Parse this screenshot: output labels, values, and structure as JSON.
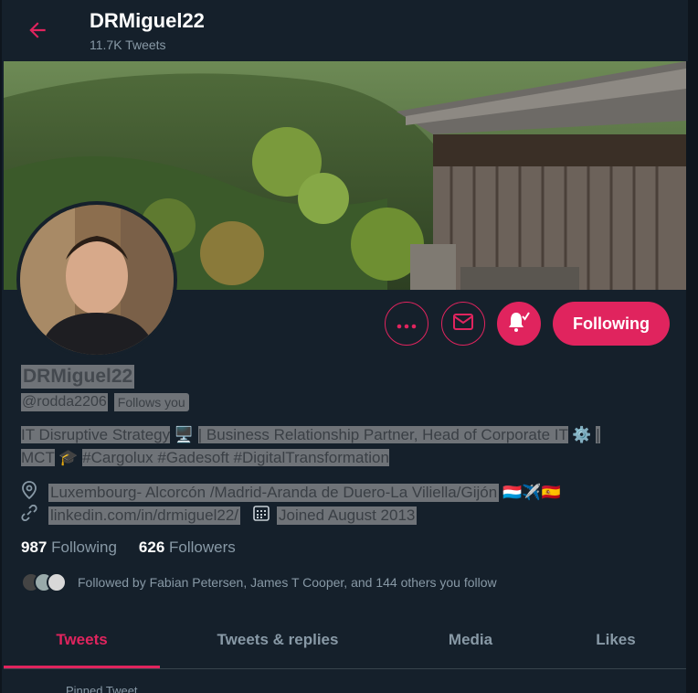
{
  "header": {
    "back_icon": "arrow-left-icon",
    "name": "DRMiguel22",
    "tweet_count": "11.7K Tweets"
  },
  "actions": {
    "more_icon": "more-dots-icon",
    "message_icon": "envelope-icon",
    "notify_icon": "bell-check-icon",
    "following_label": "Following"
  },
  "profile": {
    "name": "DRMiguel22",
    "handle": "@rodda2206",
    "follows_you": "Follows you",
    "bio_line1_a": "IT Disruptive Strategy",
    "bio_line1_b": "| Business Relationship Partner, Head of Corporate IT",
    "bio_line1_c": "|",
    "bio_line2_a": "MCT",
    "bio_line2_b": "#Cargolux #Gadesoft #DigitalTransformation",
    "location": "Luxembourg- Alcorcón /Madrid-Aranda de Duero-La Viliella/Gijón",
    "website": "linkedin.com/in/drmiguel22/",
    "joined": "Joined August 2013"
  },
  "counts": {
    "following_num": "987",
    "following_label": "Following",
    "followers_num": "626",
    "followers_label": "Followers"
  },
  "followed_by": "Followed by Fabian Petersen, James T Cooper, and 144 others you follow",
  "tabs": [
    {
      "label": "Tweets",
      "active": true
    },
    {
      "label": "Tweets & replies",
      "active": false
    },
    {
      "label": "Media",
      "active": false
    },
    {
      "label": "Likes",
      "active": false
    }
  ],
  "pinned_label": "Pinned Tweet",
  "colors": {
    "accent": "#e0245e",
    "background": "#15202b",
    "muted": "#8899a6"
  }
}
